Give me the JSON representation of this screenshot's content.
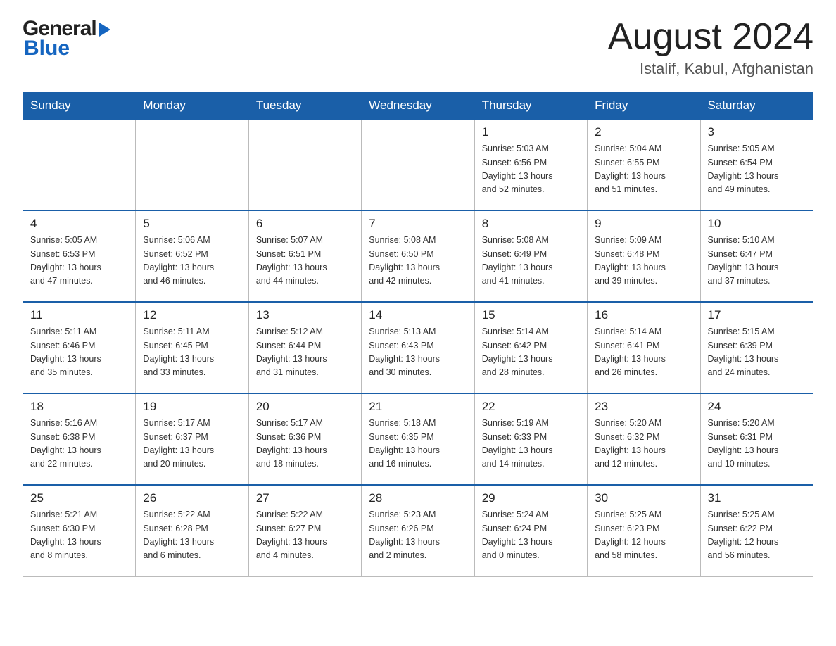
{
  "header": {
    "logo_general": "General",
    "logo_blue": "Blue",
    "month_title": "August 2024",
    "location": "Istalif, Kabul, Afghanistan"
  },
  "days_of_week": [
    "Sunday",
    "Monday",
    "Tuesday",
    "Wednesday",
    "Thursday",
    "Friday",
    "Saturday"
  ],
  "weeks": [
    [
      {
        "day": "",
        "info": ""
      },
      {
        "day": "",
        "info": ""
      },
      {
        "day": "",
        "info": ""
      },
      {
        "day": "",
        "info": ""
      },
      {
        "day": "1",
        "info": "Sunrise: 5:03 AM\nSunset: 6:56 PM\nDaylight: 13 hours\nand 52 minutes."
      },
      {
        "day": "2",
        "info": "Sunrise: 5:04 AM\nSunset: 6:55 PM\nDaylight: 13 hours\nand 51 minutes."
      },
      {
        "day": "3",
        "info": "Sunrise: 5:05 AM\nSunset: 6:54 PM\nDaylight: 13 hours\nand 49 minutes."
      }
    ],
    [
      {
        "day": "4",
        "info": "Sunrise: 5:05 AM\nSunset: 6:53 PM\nDaylight: 13 hours\nand 47 minutes."
      },
      {
        "day": "5",
        "info": "Sunrise: 5:06 AM\nSunset: 6:52 PM\nDaylight: 13 hours\nand 46 minutes."
      },
      {
        "day": "6",
        "info": "Sunrise: 5:07 AM\nSunset: 6:51 PM\nDaylight: 13 hours\nand 44 minutes."
      },
      {
        "day": "7",
        "info": "Sunrise: 5:08 AM\nSunset: 6:50 PM\nDaylight: 13 hours\nand 42 minutes."
      },
      {
        "day": "8",
        "info": "Sunrise: 5:08 AM\nSunset: 6:49 PM\nDaylight: 13 hours\nand 41 minutes."
      },
      {
        "day": "9",
        "info": "Sunrise: 5:09 AM\nSunset: 6:48 PM\nDaylight: 13 hours\nand 39 minutes."
      },
      {
        "day": "10",
        "info": "Sunrise: 5:10 AM\nSunset: 6:47 PM\nDaylight: 13 hours\nand 37 minutes."
      }
    ],
    [
      {
        "day": "11",
        "info": "Sunrise: 5:11 AM\nSunset: 6:46 PM\nDaylight: 13 hours\nand 35 minutes."
      },
      {
        "day": "12",
        "info": "Sunrise: 5:11 AM\nSunset: 6:45 PM\nDaylight: 13 hours\nand 33 minutes."
      },
      {
        "day": "13",
        "info": "Sunrise: 5:12 AM\nSunset: 6:44 PM\nDaylight: 13 hours\nand 31 minutes."
      },
      {
        "day": "14",
        "info": "Sunrise: 5:13 AM\nSunset: 6:43 PM\nDaylight: 13 hours\nand 30 minutes."
      },
      {
        "day": "15",
        "info": "Sunrise: 5:14 AM\nSunset: 6:42 PM\nDaylight: 13 hours\nand 28 minutes."
      },
      {
        "day": "16",
        "info": "Sunrise: 5:14 AM\nSunset: 6:41 PM\nDaylight: 13 hours\nand 26 minutes."
      },
      {
        "day": "17",
        "info": "Sunrise: 5:15 AM\nSunset: 6:39 PM\nDaylight: 13 hours\nand 24 minutes."
      }
    ],
    [
      {
        "day": "18",
        "info": "Sunrise: 5:16 AM\nSunset: 6:38 PM\nDaylight: 13 hours\nand 22 minutes."
      },
      {
        "day": "19",
        "info": "Sunrise: 5:17 AM\nSunset: 6:37 PM\nDaylight: 13 hours\nand 20 minutes."
      },
      {
        "day": "20",
        "info": "Sunrise: 5:17 AM\nSunset: 6:36 PM\nDaylight: 13 hours\nand 18 minutes."
      },
      {
        "day": "21",
        "info": "Sunrise: 5:18 AM\nSunset: 6:35 PM\nDaylight: 13 hours\nand 16 minutes."
      },
      {
        "day": "22",
        "info": "Sunrise: 5:19 AM\nSunset: 6:33 PM\nDaylight: 13 hours\nand 14 minutes."
      },
      {
        "day": "23",
        "info": "Sunrise: 5:20 AM\nSunset: 6:32 PM\nDaylight: 13 hours\nand 12 minutes."
      },
      {
        "day": "24",
        "info": "Sunrise: 5:20 AM\nSunset: 6:31 PM\nDaylight: 13 hours\nand 10 minutes."
      }
    ],
    [
      {
        "day": "25",
        "info": "Sunrise: 5:21 AM\nSunset: 6:30 PM\nDaylight: 13 hours\nand 8 minutes."
      },
      {
        "day": "26",
        "info": "Sunrise: 5:22 AM\nSunset: 6:28 PM\nDaylight: 13 hours\nand 6 minutes."
      },
      {
        "day": "27",
        "info": "Sunrise: 5:22 AM\nSunset: 6:27 PM\nDaylight: 13 hours\nand 4 minutes."
      },
      {
        "day": "28",
        "info": "Sunrise: 5:23 AM\nSunset: 6:26 PM\nDaylight: 13 hours\nand 2 minutes."
      },
      {
        "day": "29",
        "info": "Sunrise: 5:24 AM\nSunset: 6:24 PM\nDaylight: 13 hours\nand 0 minutes."
      },
      {
        "day": "30",
        "info": "Sunrise: 5:25 AM\nSunset: 6:23 PM\nDaylight: 12 hours\nand 58 minutes."
      },
      {
        "day": "31",
        "info": "Sunrise: 5:25 AM\nSunset: 6:22 PM\nDaylight: 12 hours\nand 56 minutes."
      }
    ]
  ]
}
